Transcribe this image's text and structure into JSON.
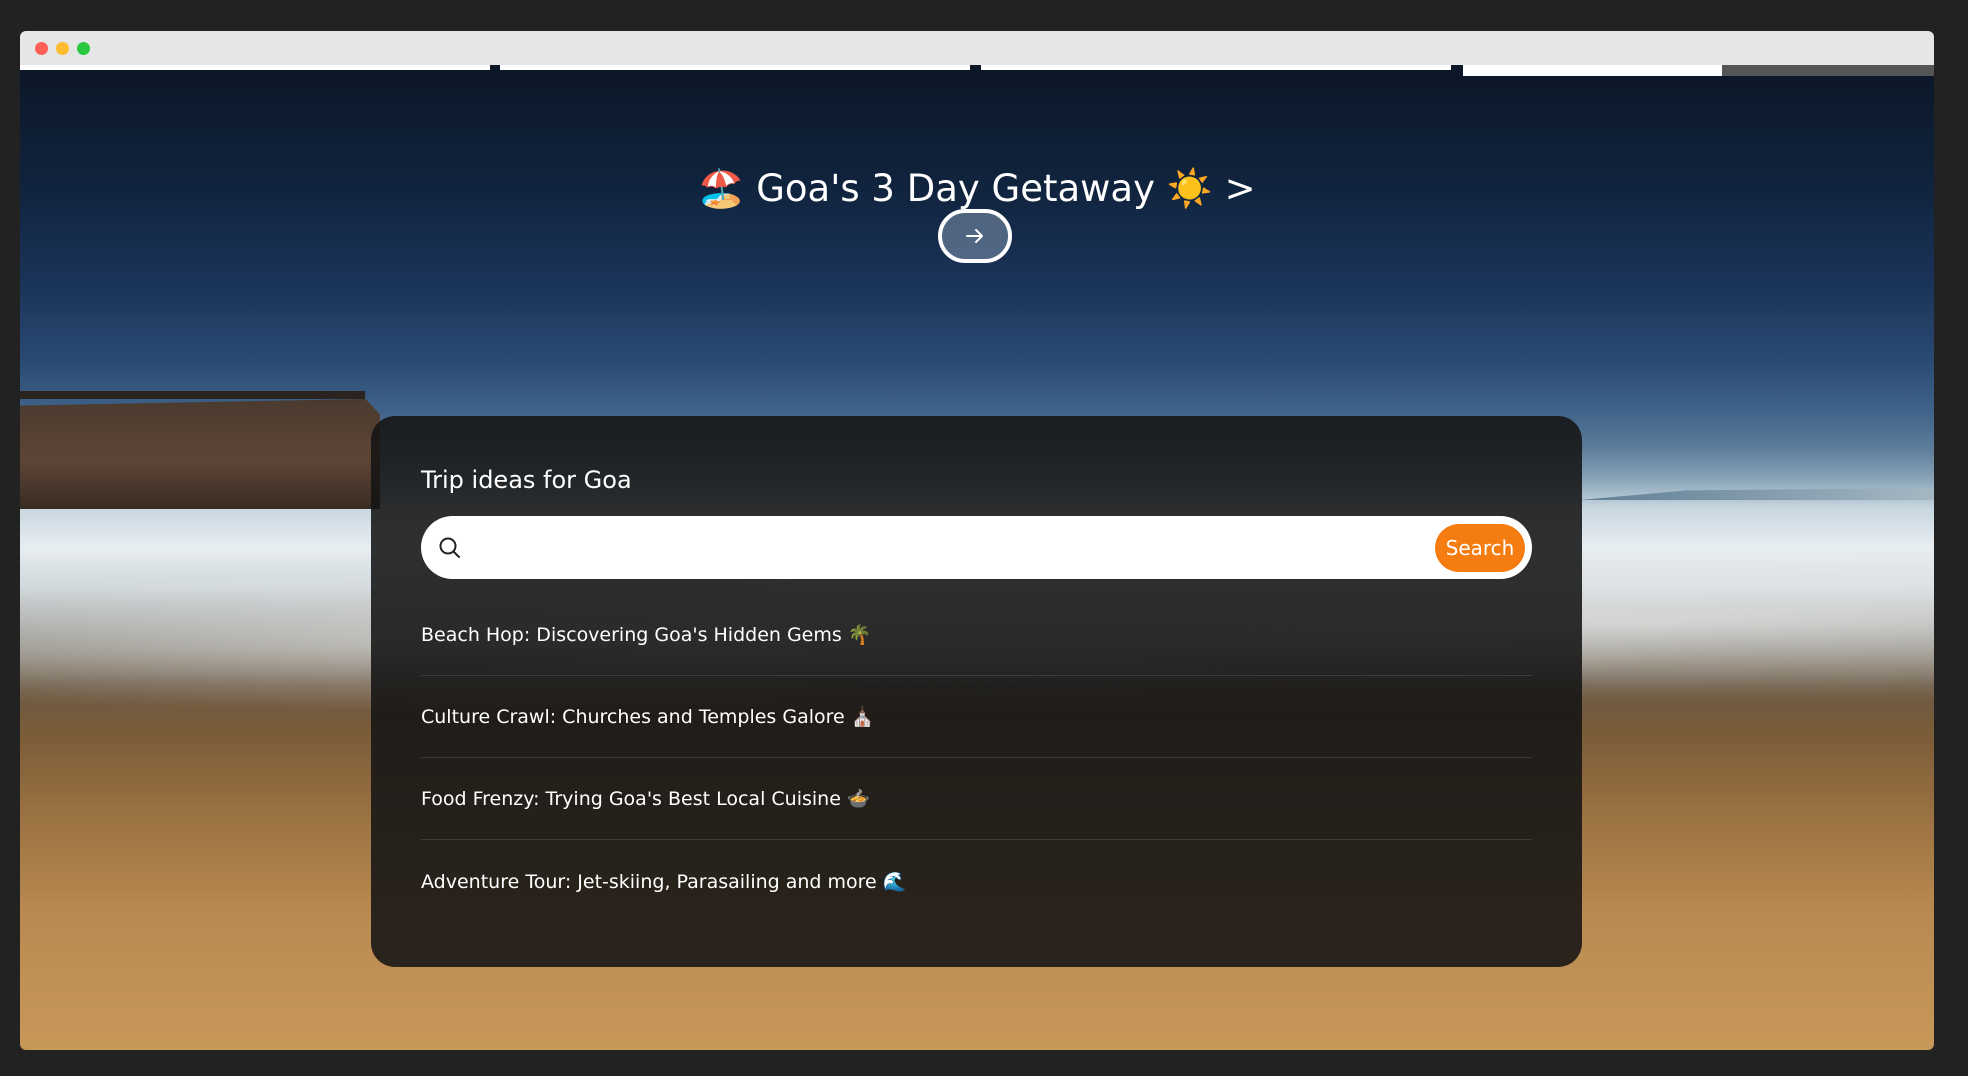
{
  "window": {
    "traffic_lights": [
      "close",
      "minimize",
      "zoom"
    ]
  },
  "story_progress": {
    "segments_total": 4,
    "current_segment": 4,
    "current_segment_progress": 0.55
  },
  "hero": {
    "title": "🏖️ Goa's 3 Day Getaway ☀️ >",
    "next_icon": "arrow-right-icon"
  },
  "panel": {
    "title": "Trip ideas for Goa",
    "search": {
      "placeholder": "",
      "value": "",
      "button_label": "Search",
      "icon": "search-icon"
    },
    "ideas": [
      {
        "label": "Beach Hop: Discovering Goa's Hidden Gems 🌴"
      },
      {
        "label": "Culture Crawl: Churches and Temples Galore ⛪"
      },
      {
        "label": "Food Frenzy: Trying Goa's Best Local Cuisine 🍲"
      },
      {
        "label": "Adventure Tour: Jet-skiing, Parasailing and more 🌊"
      }
    ]
  },
  "colors": {
    "accent": "#f57c10",
    "panel_bg": "#141414",
    "progress_fill": "#ffffff",
    "progress_track": "#555555"
  }
}
